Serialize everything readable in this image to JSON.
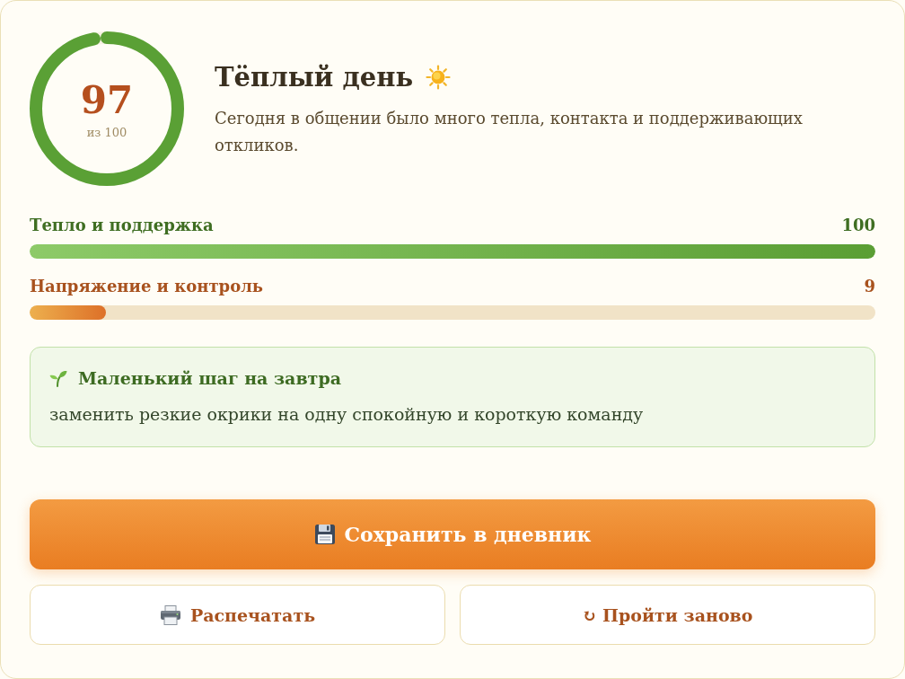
{
  "score": {
    "value": "97",
    "caption": "из 100",
    "level": 0.97
  },
  "summary": {
    "title": "Тёплый день",
    "description": "Сегодня в общении было много тепла, контакта и поддерживающих откликов."
  },
  "scales": [
    {
      "kind": "warmth",
      "label": "Тепло и поддержка",
      "value": "100",
      "level": 1.0
    },
    {
      "kind": "tension",
      "label": "Напряжение и контроль",
      "value": "9",
      "level": 0.09
    }
  ],
  "tip": {
    "title": "Маленький шаг на завтра",
    "text": "заменить резкие окрики на одну спокойную и короткую команду"
  },
  "actions": [
    {
      "kind": "save",
      "label": "Сохранить в дневник"
    },
    {
      "kind": "print",
      "label": "Распечатать"
    },
    {
      "kind": "restart",
      "label": "↻ Пройти заново"
    }
  ]
}
